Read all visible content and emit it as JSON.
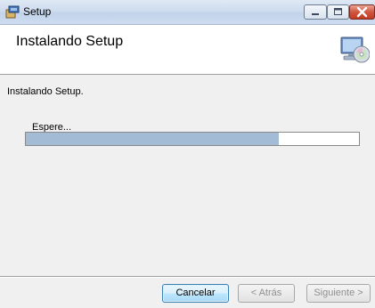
{
  "window": {
    "title": "Setup"
  },
  "header": {
    "title": "Instalando Setup"
  },
  "main": {
    "description": "Instalando Setup.",
    "wait_label": "Espere...",
    "progress_fraction": 0.76
  },
  "footer": {
    "cancel_label": "Cancelar",
    "back_label": "< Atrás",
    "next_label": "Siguiente >"
  },
  "colors": {
    "progress_fill": "#a3bbd4",
    "close_button": "#c23a22",
    "header_bg": "#ffffff"
  },
  "icons": [
    "setup-app-icon",
    "minimize-icon",
    "maximize-icon",
    "close-icon",
    "computer-cd-install-icon"
  ]
}
